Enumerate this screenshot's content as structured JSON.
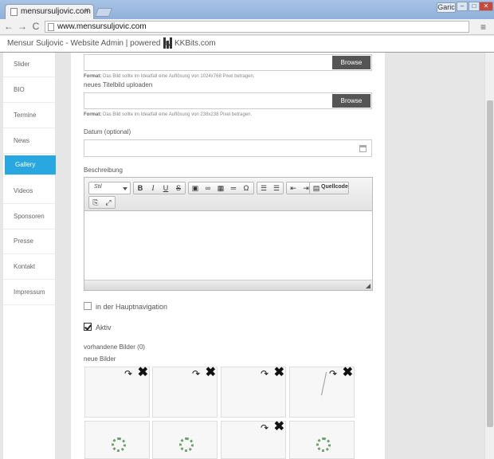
{
  "browser": {
    "tab_title": "mensursuljovic.com",
    "tab_close": "×",
    "url": "www.mensursuljovic.com",
    "user_label": "Garic",
    "win_min": "–",
    "win_max": "□",
    "win_close": "✕",
    "back": "←",
    "forward": "→",
    "reload": "C",
    "menu": "≡"
  },
  "header": {
    "title": "Mensur Suljovic - Website Admin | powered by",
    "brand": "KKBits.com"
  },
  "sidebar": {
    "items": [
      {
        "label": "Slider"
      },
      {
        "label": "BIO"
      },
      {
        "label": "Termine"
      },
      {
        "label": "News"
      },
      {
        "label": "Gallery"
      },
      {
        "label": "Videos"
      },
      {
        "label": "Sponsoren"
      },
      {
        "label": "Presse"
      },
      {
        "label": "Kontakt"
      },
      {
        "label": "Impressum"
      }
    ],
    "active_index": 4,
    "active_color": "#29a7e1"
  },
  "form": {
    "browse_label": "Browse",
    "hint1_prefix": "Format:",
    "hint1": "Das Bild sollte im Idealfall eine Auflösung von 1024x768 Pixel betragen.",
    "titlebild_label": "neues Titelbild uploaden",
    "hint2_prefix": "Format:",
    "hint2": "Das Bild sollte im Idealfall eine Auflösung von 238x238 Pixel betragen.",
    "date_label": "Datum (optional)",
    "description_label": "Beschreibung",
    "editor": {
      "style_select": "Stil",
      "bold": "B",
      "italic": "I",
      "underline": "U",
      "strike": "S",
      "image": "▣",
      "link": "∞",
      "table": "▦",
      "hr": "═",
      "omega": "Ω",
      "ol": "☰",
      "ul": "☰",
      "outdent": "⇤",
      "indent": "⇥",
      "source_label": "Quellcode",
      "paste": "⎘",
      "maximize": "⤢"
    },
    "hauptnav_label": "in der Hauptnavigation",
    "hauptnav_checked": false,
    "active_label": "Aktiv",
    "active_checked": true,
    "existing_images_label": "vorhandene Bilder (0)",
    "new_images_label": "neue Bilder"
  },
  "thumbs": {
    "rotate": "↷",
    "delete": "✖"
  }
}
